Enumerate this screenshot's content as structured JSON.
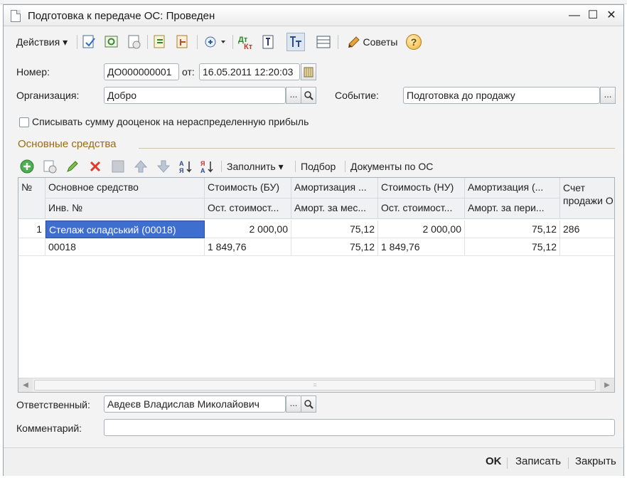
{
  "window": {
    "title": "Подготовка к передаче ОС: Проведен"
  },
  "toolbar": {
    "actions_label": "Действия ▾",
    "advice_label": "Советы",
    "help_glyph": "?"
  },
  "form": {
    "number_label": "Номер:",
    "number_value": "ДО000000001",
    "date_label": "от:",
    "date_value": "16.05.2011 12:20:03",
    "org_label": "Организация:",
    "org_value": "Добро",
    "event_label": "Событие:",
    "event_value": "Подготовка до продажу",
    "checkbox_label": "Списывать сумму дооценок на нераспределенную прибыль",
    "dots_glyph": "...",
    "search_glyph": "🔍"
  },
  "section": {
    "title": "Основные средства"
  },
  "grid_toolbar": {
    "fill_label": "Заполнить ▾",
    "pick_label": "Подбор",
    "docs_label": "Документы по ОС"
  },
  "table": {
    "headers": {
      "num": "№",
      "asset": "Основное средство",
      "inv": "Инв. №",
      "cost_bu": "Стоимость (БУ)",
      "resid_bu": "Ост. стоимост...",
      "amort_bu": "Амортизация ...",
      "amort_month": "Аморт. за мес...",
      "cost_nu": "Стоимость (НУ)",
      "resid_nu": "Ост. стоимост...",
      "amort_nu": "Амортизация (...",
      "amort_period": "Аморт. за пери...",
      "account": "Счет",
      "sale": "продажи О"
    },
    "row1": {
      "num": "1",
      "asset": "Стелаж складський (00018)",
      "cost_bu": "2 000,00",
      "amort_bu": "75,12",
      "cost_nu": "2 000,00",
      "amort_nu": "75,12",
      "account": "286"
    },
    "row2": {
      "inv": "00018",
      "resid_bu": "1 849,76",
      "amort_month": "75,12",
      "resid_nu": "1 849,76",
      "amort_period": "75,12"
    },
    "scroll_left": "◀",
    "scroll_right": "▶",
    "scroll_mark": "="
  },
  "footer": {
    "responsible_label": "Ответственный:",
    "responsible_value": "Авдеєв Владислав Миколайович",
    "comment_label": "Комментарий:",
    "comment_value": ""
  },
  "buttons": {
    "ok": "OK",
    "save": "Записать",
    "close": "Закрыть"
  },
  "window_controls": {
    "minimize": "—",
    "maximize": "☐",
    "close": "✕"
  }
}
